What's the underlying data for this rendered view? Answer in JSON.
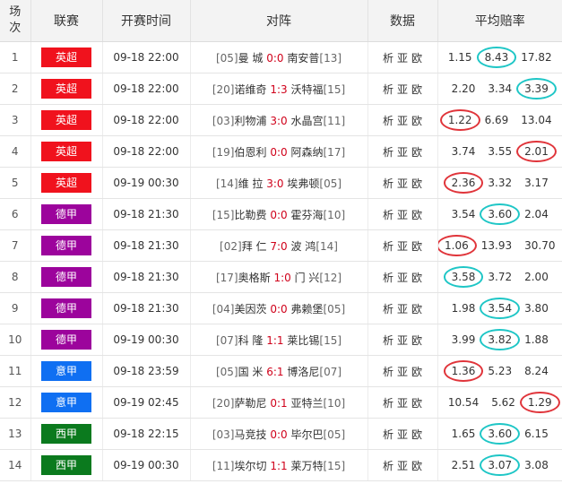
{
  "header": {
    "col_index": "场次",
    "col_league": "联赛",
    "col_time": "开赛时间",
    "col_match": "对阵",
    "col_data": "数据",
    "col_odds": "平均赔率"
  },
  "colors": {
    "英超": "#f0121d",
    "德甲": "#9c049c",
    "意甲": "#0f6ff2",
    "西甲": "#0b7a1e"
  },
  "rows": [
    {
      "idx": "1",
      "league": "英超",
      "time": "09-18 22:00",
      "home_rank": "[05]",
      "home": "曼 城",
      "score": "0:0",
      "away": "南安普",
      "away_rank": "[13]",
      "data": [
        "析",
        "亚",
        "欧"
      ],
      "odds": [
        "1.15",
        "8.43",
        "17.82"
      ],
      "marks": [
        "",
        "cyan",
        ""
      ]
    },
    {
      "idx": "2",
      "league": "英超",
      "time": "09-18 22:00",
      "home_rank": "[20]",
      "home": "诺维奇",
      "score": "1:3",
      "away": "沃特福",
      "away_rank": "[15]",
      "data": [
        "析",
        "亚",
        "欧"
      ],
      "odds": [
        "2.20",
        "3.34",
        "3.39"
      ],
      "marks": [
        "",
        "",
        "cyan"
      ]
    },
    {
      "idx": "3",
      "league": "英超",
      "time": "09-18 22:00",
      "home_rank": "[03]",
      "home": "利物浦",
      "score": "3:0",
      "away": "水晶宫",
      "away_rank": "[11]",
      "data": [
        "析",
        "亚",
        "欧"
      ],
      "odds": [
        "1.22",
        "6.69",
        "13.04"
      ],
      "marks": [
        "red",
        "",
        ""
      ]
    },
    {
      "idx": "4",
      "league": "英超",
      "time": "09-18 22:00",
      "home_rank": "[19]",
      "home": "伯恩利",
      "score": "0:0",
      "away": "阿森纳",
      "away_rank": "[17]",
      "data": [
        "析",
        "亚",
        "欧"
      ],
      "odds": [
        "3.74",
        "3.55",
        "2.01"
      ],
      "marks": [
        "",
        "",
        "red"
      ]
    },
    {
      "idx": "5",
      "league": "英超",
      "time": "09-19 00:30",
      "home_rank": "[14]",
      "home": "维 拉",
      "score": "3:0",
      "away": "埃弗顿",
      "away_rank": "[05]",
      "data": [
        "析",
        "亚",
        "欧"
      ],
      "odds": [
        "2.36",
        "3.32",
        "3.17"
      ],
      "marks": [
        "red",
        "",
        ""
      ]
    },
    {
      "idx": "6",
      "league": "德甲",
      "time": "09-18 21:30",
      "home_rank": "[15]",
      "home": "比勒费",
      "score": "0:0",
      "away": "霍芬海",
      "away_rank": "[10]",
      "data": [
        "析",
        "亚",
        "欧"
      ],
      "odds": [
        "3.54",
        "3.60",
        "2.04"
      ],
      "marks": [
        "",
        "cyan",
        ""
      ]
    },
    {
      "idx": "7",
      "league": "德甲",
      "time": "09-18 21:30",
      "home_rank": "[02]",
      "home": "拜 仁",
      "score": "7:0",
      "away": "波 鸿",
      "away_rank": "[14]",
      "data": [
        "析",
        "亚",
        "欧"
      ],
      "odds": [
        "1.06",
        "13.93",
        "30.70"
      ],
      "marks": [
        "red",
        "",
        ""
      ]
    },
    {
      "idx": "8",
      "league": "德甲",
      "time": "09-18 21:30",
      "home_rank": "[17]",
      "home": "奥格斯",
      "score": "1:0",
      "away": "门 兴",
      "away_rank": "[12]",
      "data": [
        "析",
        "亚",
        "欧"
      ],
      "odds": [
        "3.58",
        "3.72",
        "2.00"
      ],
      "marks": [
        "cyan",
        "",
        ""
      ]
    },
    {
      "idx": "9",
      "league": "德甲",
      "time": "09-18 21:30",
      "home_rank": "[04]",
      "home": "美因茨",
      "score": "0:0",
      "away": "弗赖堡",
      "away_rank": "[05]",
      "data": [
        "析",
        "亚",
        "欧"
      ],
      "odds": [
        "1.98",
        "3.54",
        "3.80"
      ],
      "marks": [
        "",
        "cyan",
        ""
      ]
    },
    {
      "idx": "10",
      "league": "德甲",
      "time": "09-19 00:30",
      "home_rank": "[07]",
      "home": "科 隆",
      "score": "1:1",
      "away": "莱比锡",
      "away_rank": "[15]",
      "data": [
        "析",
        "亚",
        "欧"
      ],
      "odds": [
        "3.99",
        "3.82",
        "1.88"
      ],
      "marks": [
        "",
        "cyan",
        ""
      ]
    },
    {
      "idx": "11",
      "league": "意甲",
      "time": "09-18 23:59",
      "home_rank": "[05]",
      "home": "国 米",
      "score": "6:1",
      "away": "博洛尼",
      "away_rank": "[07]",
      "data": [
        "析",
        "亚",
        "欧"
      ],
      "odds": [
        "1.36",
        "5.23",
        "8.24"
      ],
      "marks": [
        "red",
        "",
        ""
      ]
    },
    {
      "idx": "12",
      "league": "意甲",
      "time": "09-19 02:45",
      "home_rank": "[20]",
      "home": "萨勒尼",
      "score": "0:1",
      "away": "亚特兰",
      "away_rank": "[10]",
      "data": [
        "析",
        "亚",
        "欧"
      ],
      "odds": [
        "10.54",
        "5.62",
        "1.29"
      ],
      "marks": [
        "",
        "",
        "red"
      ]
    },
    {
      "idx": "13",
      "league": "西甲",
      "time": "09-18 22:15",
      "home_rank": "[03]",
      "home": "马竞技",
      "score": "0:0",
      "away": "毕尔巴",
      "away_rank": "[05]",
      "data": [
        "析",
        "亚",
        "欧"
      ],
      "odds": [
        "1.65",
        "3.60",
        "6.15"
      ],
      "marks": [
        "",
        "cyan",
        ""
      ]
    },
    {
      "idx": "14",
      "league": "西甲",
      "time": "09-19 00:30",
      "home_rank": "[11]",
      "home": "埃尔切",
      "score": "1:1",
      "away": "莱万特",
      "away_rank": "[15]",
      "data": [
        "析",
        "亚",
        "欧"
      ],
      "odds": [
        "2.51",
        "3.07",
        "3.08"
      ],
      "marks": [
        "",
        "cyan",
        ""
      ]
    }
  ]
}
